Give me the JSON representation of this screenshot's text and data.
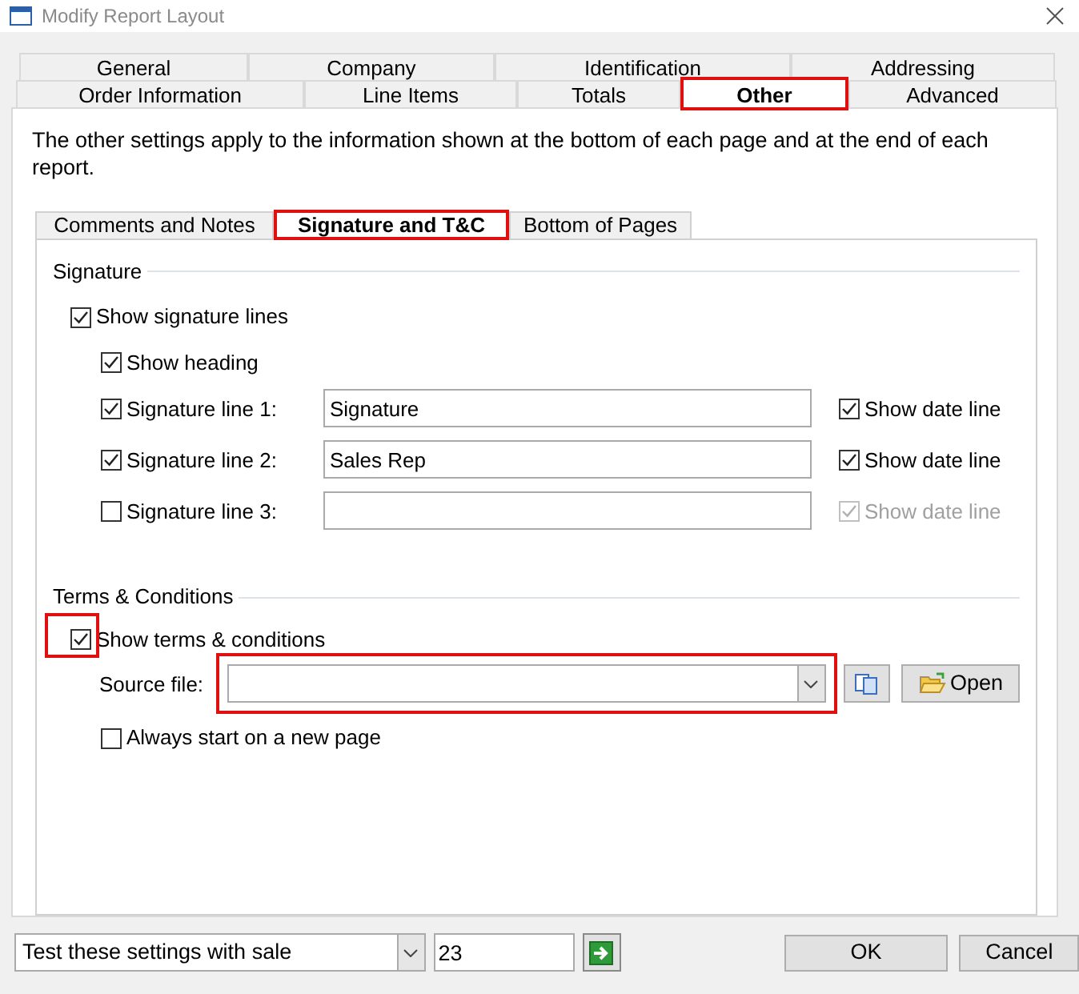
{
  "window": {
    "title": "Modify Report Layout"
  },
  "outer_tabs": [
    [
      {
        "label": "General",
        "selected": false,
        "highlighted": false
      },
      {
        "label": "Company",
        "selected": false,
        "highlighted": false
      },
      {
        "label": "Identification",
        "selected": false,
        "highlighted": false
      },
      {
        "label": "Addressing",
        "selected": false,
        "highlighted": false
      }
    ],
    [
      {
        "label": "Order Information",
        "selected": false,
        "highlighted": false
      },
      {
        "label": "Line Items",
        "selected": false,
        "highlighted": false
      },
      {
        "label": "Totals",
        "selected": false,
        "highlighted": false
      },
      {
        "label": "Other",
        "selected": true,
        "highlighted": true
      },
      {
        "label": "Advanced",
        "selected": false,
        "highlighted": false
      }
    ]
  ],
  "description": "The other settings apply to the information shown at the bottom of each page and at the end of each report.",
  "inner_tabs": [
    {
      "label": "Comments and Notes",
      "selected": false,
      "highlighted": false
    },
    {
      "label": "Signature and T&C",
      "selected": true,
      "highlighted": true
    },
    {
      "label": "Bottom of Pages",
      "selected": false,
      "highlighted": false
    }
  ],
  "signature": {
    "heading": "Signature",
    "show_lines": {
      "label": "Show signature lines",
      "checked": true
    },
    "show_heading": {
      "label": "Show heading",
      "checked": true
    },
    "lines": [
      {
        "label": "Signature line 1:",
        "checked": true,
        "value": "Signature",
        "date_line": {
          "label": "Show date line",
          "checked": true,
          "disabled": false
        }
      },
      {
        "label": "Signature line 2:",
        "checked": true,
        "value": "Sales Rep",
        "date_line": {
          "label": "Show date line",
          "checked": true,
          "disabled": false
        }
      },
      {
        "label": "Signature line 3:",
        "checked": false,
        "date_line": {
          "label": "Show date line",
          "checked": true,
          "disabled": true
        }
      }
    ]
  },
  "terms": {
    "heading": "Terms & Conditions",
    "show": {
      "label": "Show terms & conditions",
      "checked": true,
      "highlighted": true
    },
    "source_file": {
      "label": "Source file:",
      "highlighted": true
    },
    "open_button": "Open",
    "always_new_page": {
      "label": "Always start on a new page",
      "checked": false
    }
  },
  "footer": {
    "test_select": "Test these settings with sale",
    "sale_number": "23",
    "buttons": [
      "OK",
      "Cancel"
    ]
  }
}
